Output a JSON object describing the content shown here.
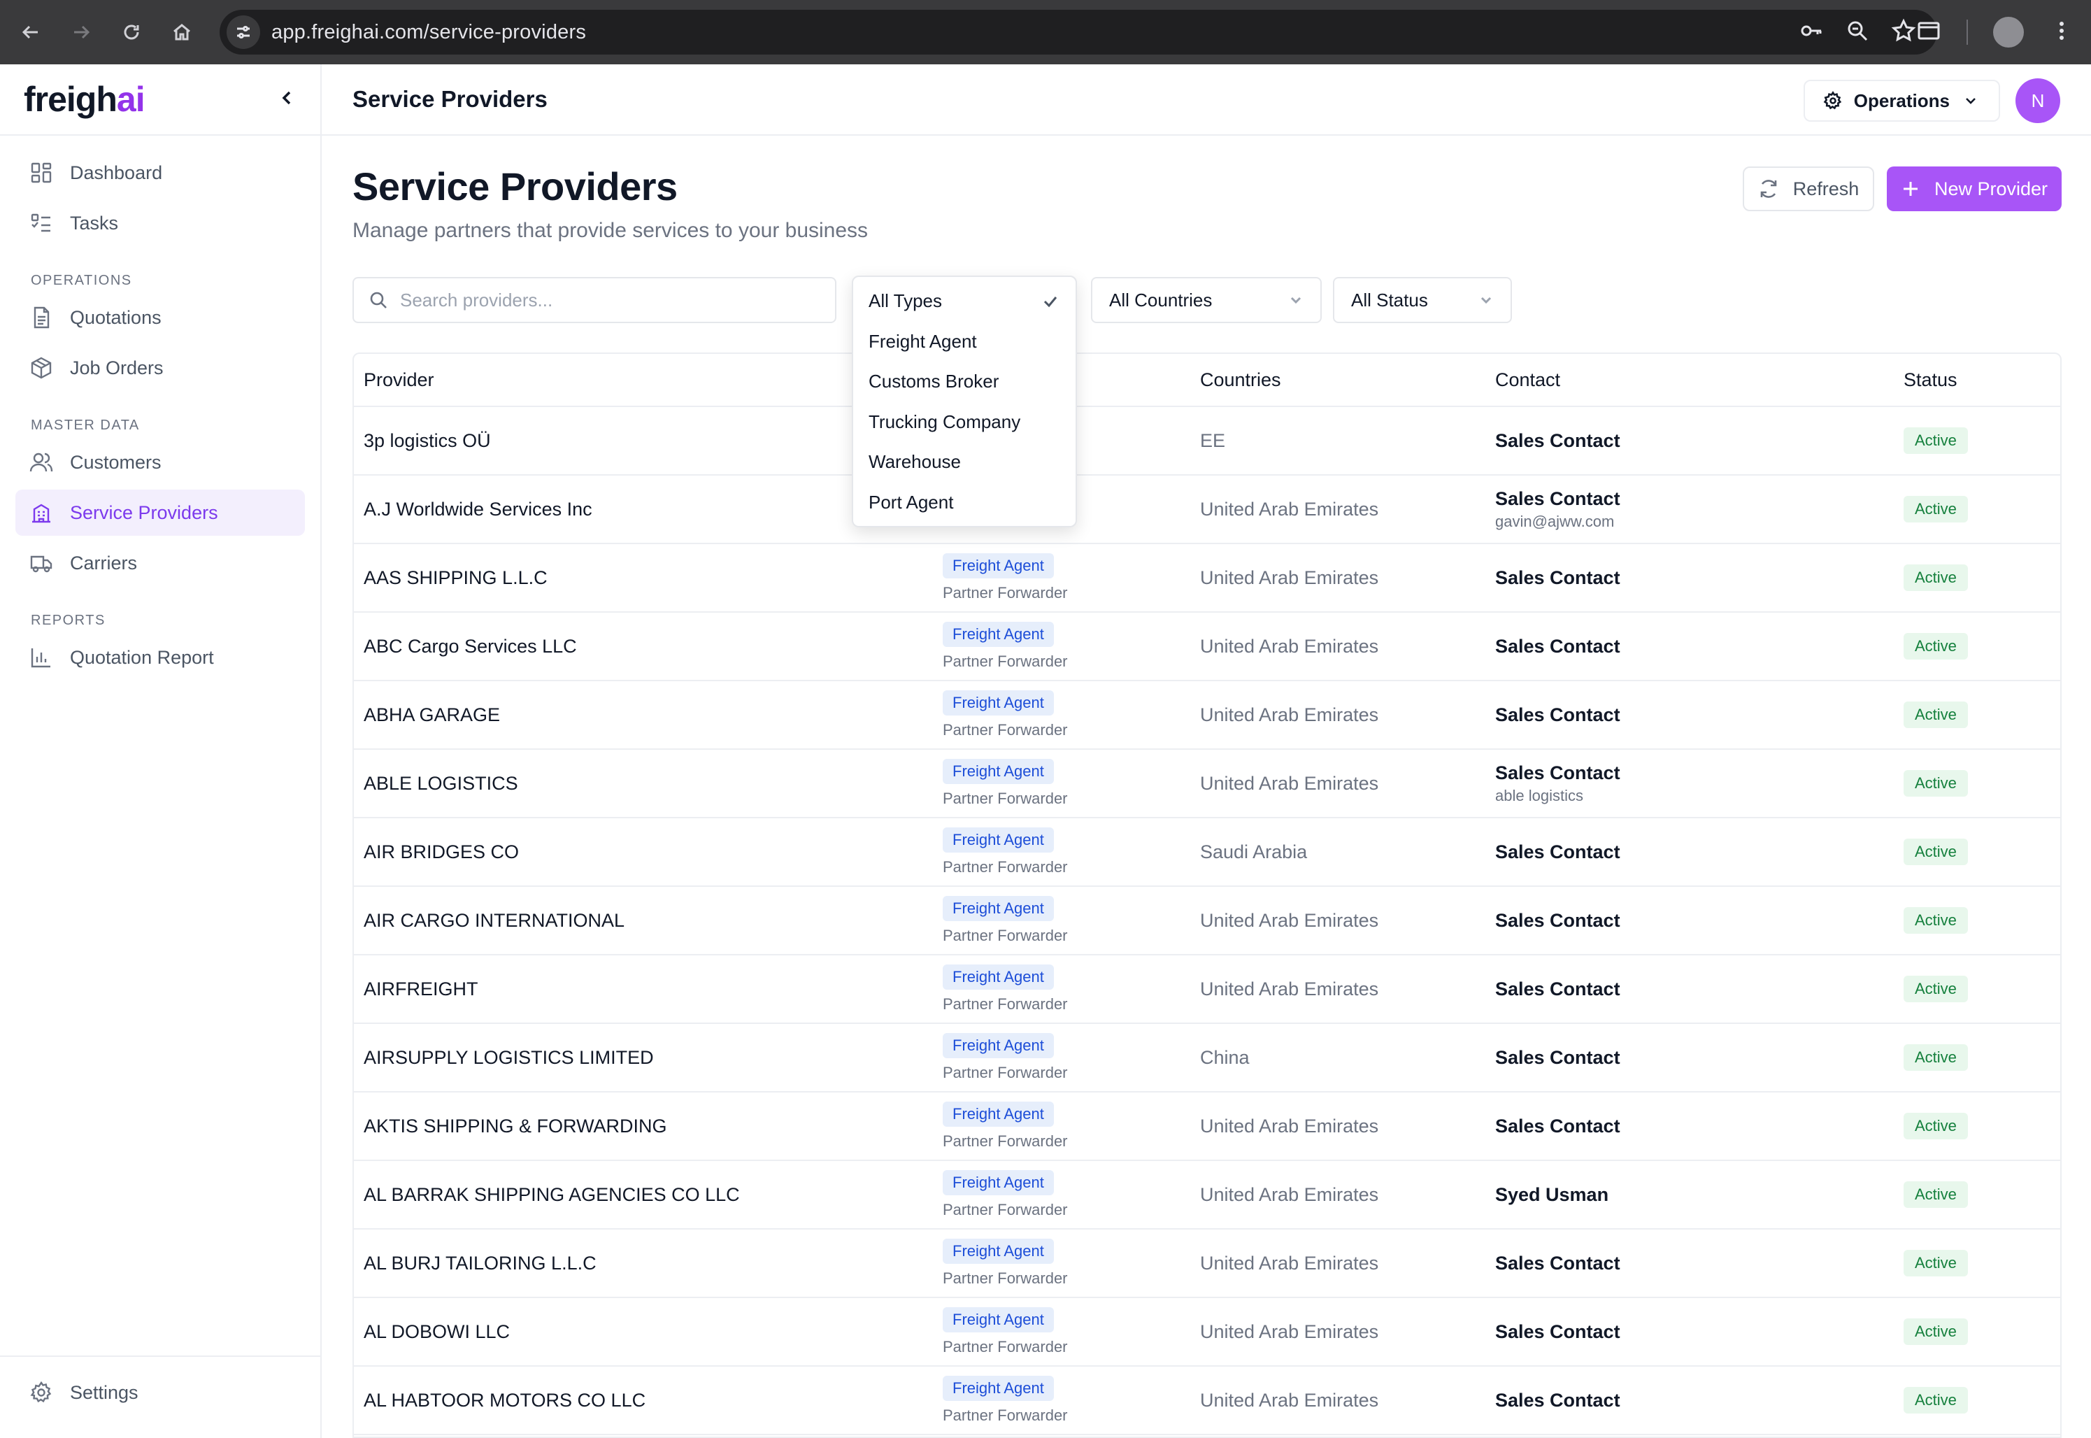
{
  "browser": {
    "url": "app.freighai.com/service-providers"
  },
  "sidebar": {
    "logo_main": "freigh",
    "logo_accent": "ai",
    "items_top": [
      {
        "label": "Dashboard",
        "icon": "dashboard-icon"
      },
      {
        "label": "Tasks",
        "icon": "tasks-icon"
      }
    ],
    "section_operations": "OPERATIONS",
    "items_operations": [
      {
        "label": "Quotations",
        "icon": "document-icon"
      },
      {
        "label": "Job Orders",
        "icon": "box-icon"
      }
    ],
    "section_master": "MASTER DATA",
    "items_master": [
      {
        "label": "Customers",
        "icon": "users-icon"
      },
      {
        "label": "Service Providers",
        "icon": "building-icon",
        "active": true
      },
      {
        "label": "Carriers",
        "icon": "truck-icon"
      }
    ],
    "section_reports": "REPORTS",
    "items_reports": [
      {
        "label": "Quotation Report",
        "icon": "bar-chart-icon"
      }
    ],
    "settings_label": "Settings"
  },
  "header": {
    "title": "Service Providers",
    "workspace": "Operations",
    "avatar_initial": "N"
  },
  "page": {
    "title": "Service Providers",
    "subtitle": "Manage partners that provide services to your business",
    "refresh_label": "Refresh",
    "new_label": "New Provider",
    "search_placeholder": "Search providers...",
    "filter_countries": "All Countries",
    "filter_status": "All Status"
  },
  "type_dropdown": {
    "options": [
      "All Types",
      "Freight Agent",
      "Customs Broker",
      "Trucking Company",
      "Warehouse",
      "Port Agent"
    ],
    "selected": "All Types"
  },
  "table": {
    "headers": {
      "provider": "Provider",
      "countries": "Countries",
      "contact": "Contact",
      "status": "Status"
    },
    "rows": [
      {
        "provider": "3p logistics OÜ",
        "type": "",
        "type_sub": "",
        "country": "EE",
        "contact": "Sales Contact",
        "contact_sub": "",
        "status": "Active"
      },
      {
        "provider": "A.J Worldwide Services Inc",
        "type": "",
        "type_sub": "",
        "country": "United Arab Emirates",
        "contact": "Sales Contact",
        "contact_sub": "gavin@ajww.com",
        "status": "Active"
      },
      {
        "provider": "AAS SHIPPING L.L.C",
        "type": "Freight Agent",
        "type_sub": "Partner Forwarder",
        "country": "United Arab Emirates",
        "contact": "Sales Contact",
        "contact_sub": "",
        "status": "Active"
      },
      {
        "provider": "ABC Cargo Services LLC",
        "type": "Freight Agent",
        "type_sub": "Partner Forwarder",
        "country": "United Arab Emirates",
        "contact": "Sales Contact",
        "contact_sub": "",
        "status": "Active"
      },
      {
        "provider": "ABHA GARAGE",
        "type": "Freight Agent",
        "type_sub": "Partner Forwarder",
        "country": "United Arab Emirates",
        "contact": "Sales Contact",
        "contact_sub": "",
        "status": "Active"
      },
      {
        "provider": "ABLE LOGISTICS",
        "type": "Freight Agent",
        "type_sub": "Partner Forwarder",
        "country": "United Arab Emirates",
        "contact": "Sales Contact",
        "contact_sub": "able logistics",
        "status": "Active"
      },
      {
        "provider": "AIR BRIDGES CO",
        "type": "Freight Agent",
        "type_sub": "Partner Forwarder",
        "country": "Saudi Arabia",
        "contact": "Sales Contact",
        "contact_sub": "",
        "status": "Active"
      },
      {
        "provider": "AIR CARGO INTERNATIONAL",
        "type": "Freight Agent",
        "type_sub": "Partner Forwarder",
        "country": "United Arab Emirates",
        "contact": "Sales Contact",
        "contact_sub": "",
        "status": "Active"
      },
      {
        "provider": "AIRFREIGHT",
        "type": "Freight Agent",
        "type_sub": "Partner Forwarder",
        "country": "United Arab Emirates",
        "contact": "Sales Contact",
        "contact_sub": "",
        "status": "Active"
      },
      {
        "provider": "AIRSUPPLY LOGISTICS LIMITED",
        "type": "Freight Agent",
        "type_sub": "Partner Forwarder",
        "country": "China",
        "contact": "Sales Contact",
        "contact_sub": "",
        "status": "Active"
      },
      {
        "provider": "AKTIS SHIPPING & FORWARDING",
        "type": "Freight Agent",
        "type_sub": "Partner Forwarder",
        "country": "United Arab Emirates",
        "contact": "Sales Contact",
        "contact_sub": "",
        "status": "Active"
      },
      {
        "provider": "AL BARRAK SHIPPING AGENCIES CO LLC",
        "type": "Freight Agent",
        "type_sub": "Partner Forwarder",
        "country": "United Arab Emirates",
        "contact": "Syed Usman",
        "contact_sub": "",
        "status": "Active"
      },
      {
        "provider": "AL BURJ TAILORING L.L.C",
        "type": "Freight Agent",
        "type_sub": "Partner Forwarder",
        "country": "United Arab Emirates",
        "contact": "Sales Contact",
        "contact_sub": "",
        "status": "Active"
      },
      {
        "provider": "AL DOBOWI LLC",
        "type": "Freight Agent",
        "type_sub": "Partner Forwarder",
        "country": "United Arab Emirates",
        "contact": "Sales Contact",
        "contact_sub": "",
        "status": "Active"
      },
      {
        "provider": "AL HABTOOR MOTORS CO LLC",
        "type": "Freight Agent",
        "type_sub": "Partner Forwarder",
        "country": "United Arab Emirates",
        "contact": "Sales Contact",
        "contact_sub": "",
        "status": "Active"
      }
    ]
  },
  "colors": {
    "accent": "#a855f7",
    "active_nav": "#7c3aed",
    "status_green": "#15803d",
    "type_blue": "#1d4ed8"
  }
}
